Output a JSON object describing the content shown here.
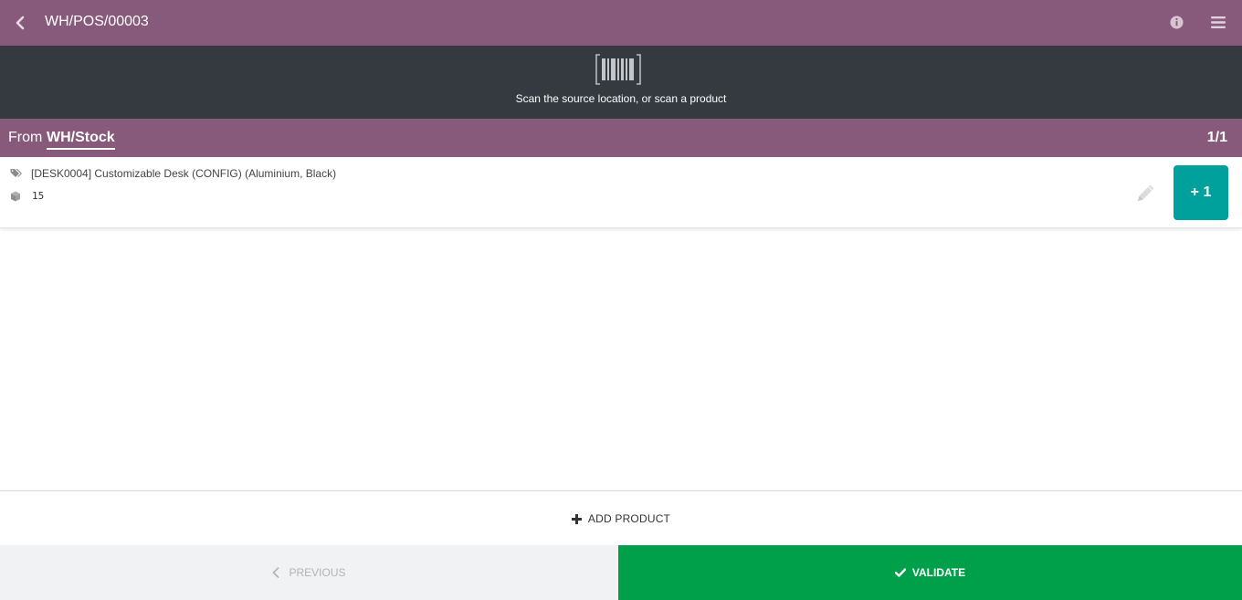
{
  "header": {
    "title": "WH/POS/00003",
    "back_icon": "chevron-left-icon",
    "info_icon": "info-circle-icon",
    "menu_icon": "hamburger-menu-icon"
  },
  "scan": {
    "icon": "barcode-icon",
    "instruction": "Scan the source location, or scan a product"
  },
  "location": {
    "from_label": "From",
    "source": "WH/Stock",
    "page_count": "1/1"
  },
  "lines": [
    {
      "product": "[DESK0004] Customizable Desk (CONFIG) (Aluminium, Black)",
      "quantity": "15",
      "increment_label": "+ 1"
    }
  ],
  "footer": {
    "add_product_label": "ADD PRODUCT",
    "previous_label": "PREVIOUS",
    "validate_label": "VALIDATE"
  },
  "colors": {
    "brand_purple": "#875a7b",
    "scan_bar": "#343a40",
    "increment_teal": "#00a09d",
    "validate_green": "#00a04a",
    "previous_bg": "#f1f2f4"
  }
}
